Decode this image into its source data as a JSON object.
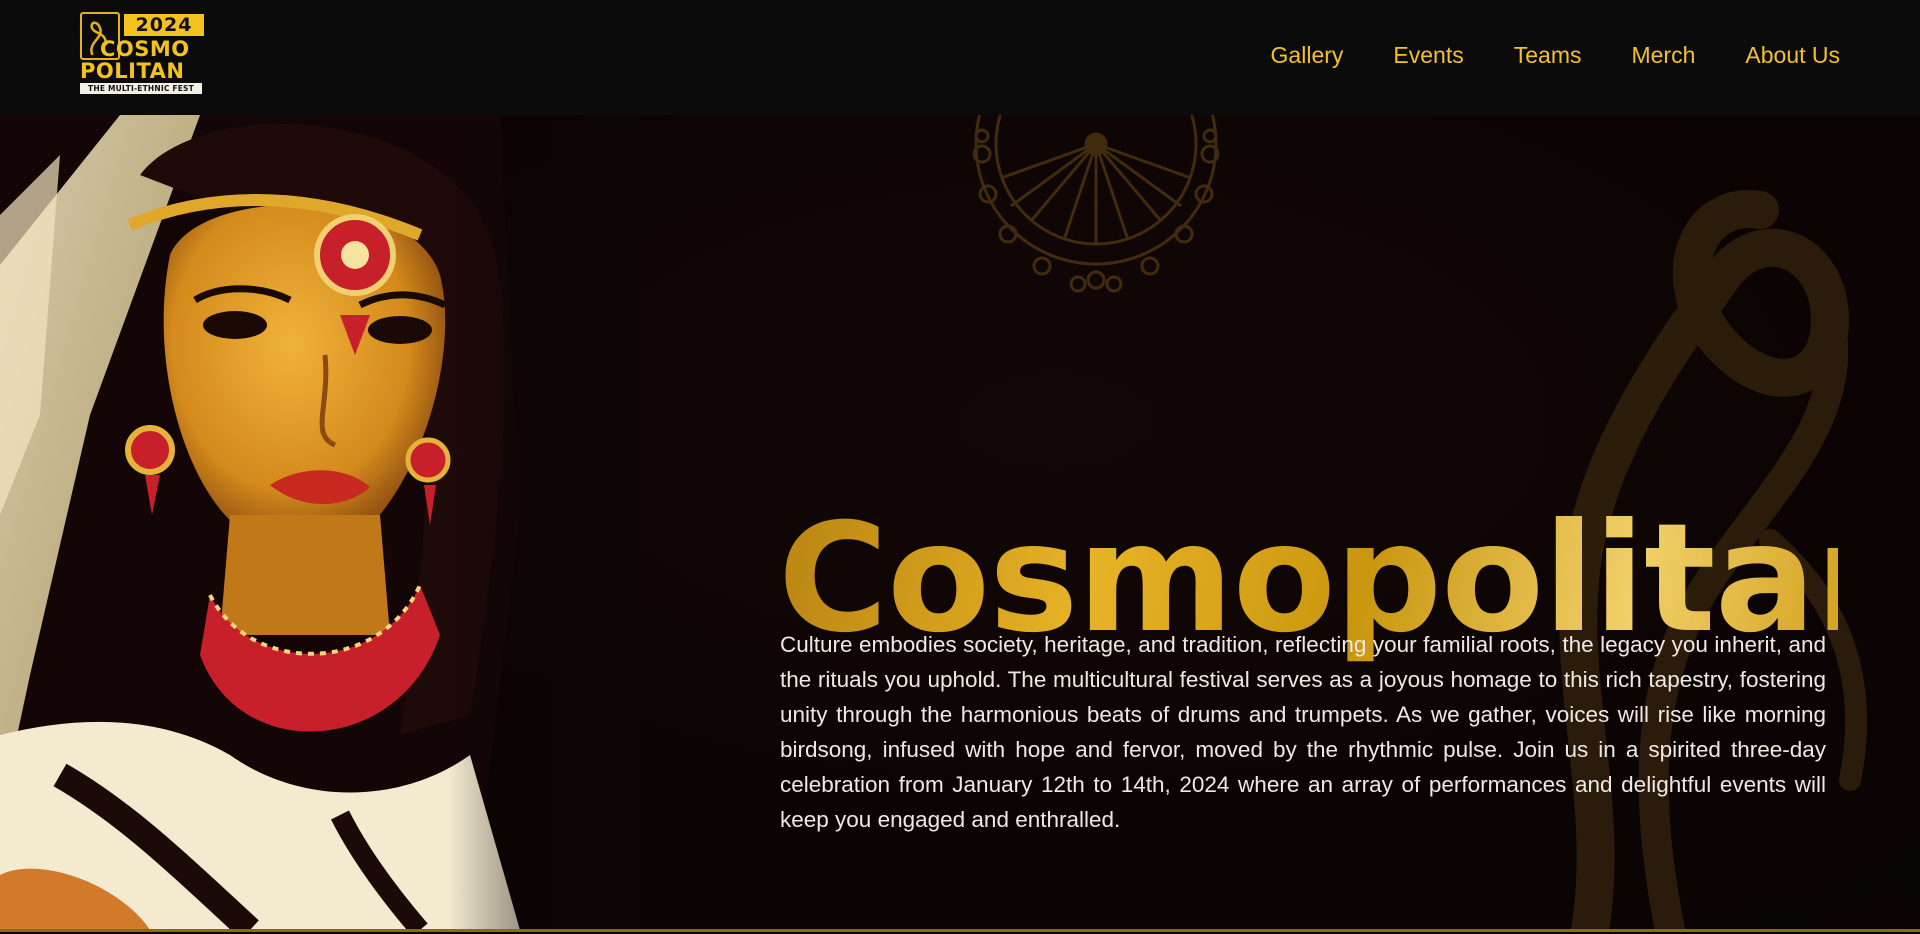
{
  "brand": {
    "year": "2024",
    "name_line1": "COSMO",
    "name_line2": "POLITAN",
    "tagline": "THE MULTI-ETHNIC FEST"
  },
  "nav": {
    "items": [
      {
        "label": "Gallery"
      },
      {
        "label": "Events"
      },
      {
        "label": "Teams"
      },
      {
        "label": "Merch"
      },
      {
        "label": "About Us"
      }
    ]
  },
  "hero": {
    "title": "Cosmopolitan",
    "description": "Culture embodies society, heritage, and tradition, reflecting your familial roots, the legacy you inherit, and the rituals you uphold. The multicultural festival serves as a joyous homage to this rich tapestry, fostering unity through the harmonious beats of drums and trumpets. As we gather, voices will rise like morning birdsong, infused with hope and fervor, moved by the rhythmic pulse. Join us in a spirited three-day celebration from January 12th to 14th, 2024 where an array of performances and delightful events will keep you engaged and enthralled."
  },
  "colors": {
    "accent": "#f3c12a",
    "gold": "#e2b11c",
    "background": "#0c0505",
    "header": "#0b0b0b",
    "text": "#efe9e2"
  },
  "icons": {
    "portrait": "festival-portrait-illustration",
    "mandala": "mandala-ornament-icon",
    "swirl": "swirl-ornament-icon"
  }
}
